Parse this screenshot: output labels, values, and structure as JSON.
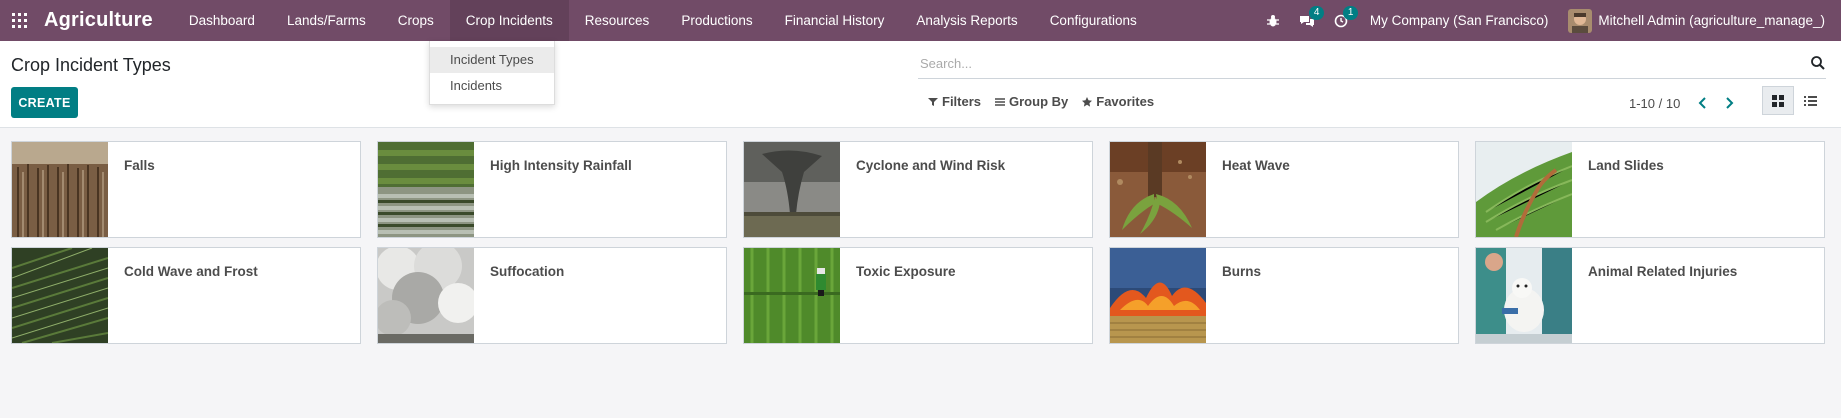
{
  "app": {
    "name": "Agriculture"
  },
  "nav": {
    "items": [
      {
        "label": "Dashboard"
      },
      {
        "label": "Lands/Farms"
      },
      {
        "label": "Crops"
      },
      {
        "label": "Crop Incidents"
      },
      {
        "label": "Resources"
      },
      {
        "label": "Productions"
      },
      {
        "label": "Financial History"
      },
      {
        "label": "Analysis Reports"
      },
      {
        "label": "Configurations"
      }
    ],
    "messages_count": "4",
    "activities_count": "1",
    "company": "My Company (San Francisco)",
    "user": "Mitchell Admin (agriculture_manage_)"
  },
  "dropdown": {
    "items": [
      {
        "label": "Incident Types"
      },
      {
        "label": "Incidents"
      }
    ]
  },
  "control_panel": {
    "title": "Crop Incident Types",
    "create_label": "CREATE",
    "search_placeholder": "Search...",
    "filters_label": "Filters",
    "groupby_label": "Group By",
    "favorites_label": "Favorites",
    "pager": "1-10 / 10"
  },
  "cards": [
    {
      "title": "Falls",
      "image": "field-crops"
    },
    {
      "title": "High Intensity Rainfall",
      "image": "flooded-field"
    },
    {
      "title": "Cyclone and Wind Risk",
      "image": "tornado"
    },
    {
      "title": "Heat Wave",
      "image": "wilted-plant"
    },
    {
      "title": "Land Slides",
      "image": "green-hillside"
    },
    {
      "title": "Cold Wave and Frost",
      "image": "frosted-grass"
    },
    {
      "title": "Suffocation",
      "image": "smoke"
    },
    {
      "title": "Toxic Exposure",
      "image": "crop-sprayer"
    },
    {
      "title": "Burns",
      "image": "field-fire"
    },
    {
      "title": "Animal Related Injuries",
      "image": "vet-with-dog"
    }
  ],
  "colors": {
    "navbar": "#714b67",
    "primary": "#017e84",
    "background": "#f5f5f7"
  }
}
